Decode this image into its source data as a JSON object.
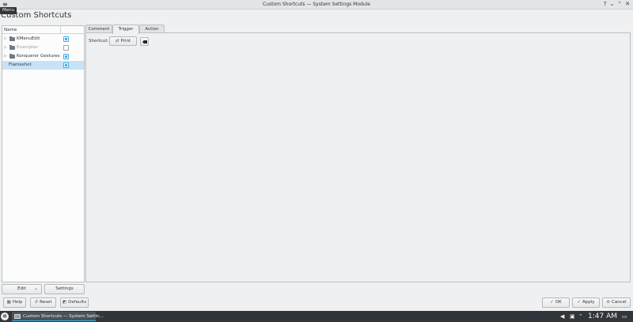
{
  "window": {
    "title": "Custom Shortcuts — System Settings Module",
    "menu_tooltip": "Menu",
    "controls": [
      "?",
      "⌄",
      "⌃",
      "✕"
    ]
  },
  "page": {
    "title": "Custom Shortcuts"
  },
  "tree": {
    "header_name": "Name",
    "items": [
      {
        "label": "KMenuEdit",
        "checked": true,
        "disabled": false
      },
      {
        "label": "Examples",
        "checked": false,
        "disabled": true
      },
      {
        "label": "Konqueror Gestures",
        "checked": true,
        "disabled": false
      },
      {
        "label": "Flameshot",
        "checked": true,
        "disabled": false,
        "selected": true
      }
    ]
  },
  "left_buttons": {
    "edit": "Edit",
    "settings": "Settings"
  },
  "tabs": [
    {
      "label": "Comment",
      "active": false
    },
    {
      "label": "Trigger",
      "active": true
    },
    {
      "label": "Action",
      "active": false
    }
  ],
  "trigger": {
    "shortcut_label": "Shortcut:",
    "shortcut_value": "Print"
  },
  "bottom": {
    "help": "Help",
    "reset": "Reset",
    "defaults": "Defaults",
    "ok": "OK",
    "apply": "Apply",
    "cancel": "Cancel"
  },
  "taskbar": {
    "task_label": "Custom Shortcuts — System Settin...",
    "clock": "1:47 AM"
  },
  "colors": {
    "accent": "#3daee9",
    "selection": "#c7e1f6",
    "taskbar": "#31363b"
  }
}
